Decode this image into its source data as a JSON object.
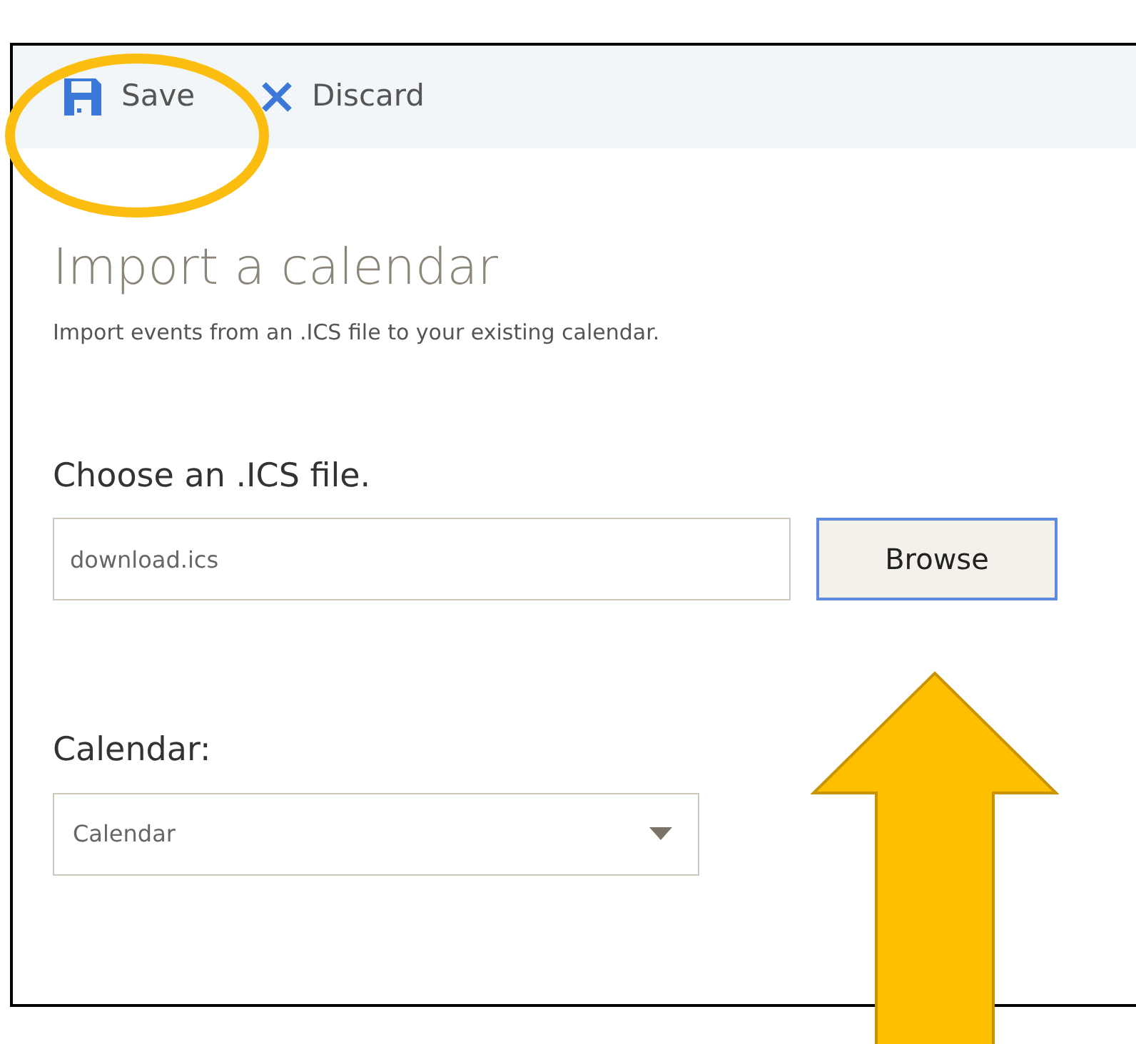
{
  "toolbar": {
    "buttons": [
      {
        "kind": "save",
        "label": "Save"
      },
      {
        "kind": "discard",
        "label": "Discard"
      }
    ]
  },
  "title": "Import a calendar",
  "description": "Import events from an .ICS file to your existing calendar.",
  "file_section": {
    "label": "Choose an .ICS file.",
    "value": "download.ics",
    "button": "Browse"
  },
  "calendar_section": {
    "label": "Calendar:",
    "value": "Calendar"
  }
}
